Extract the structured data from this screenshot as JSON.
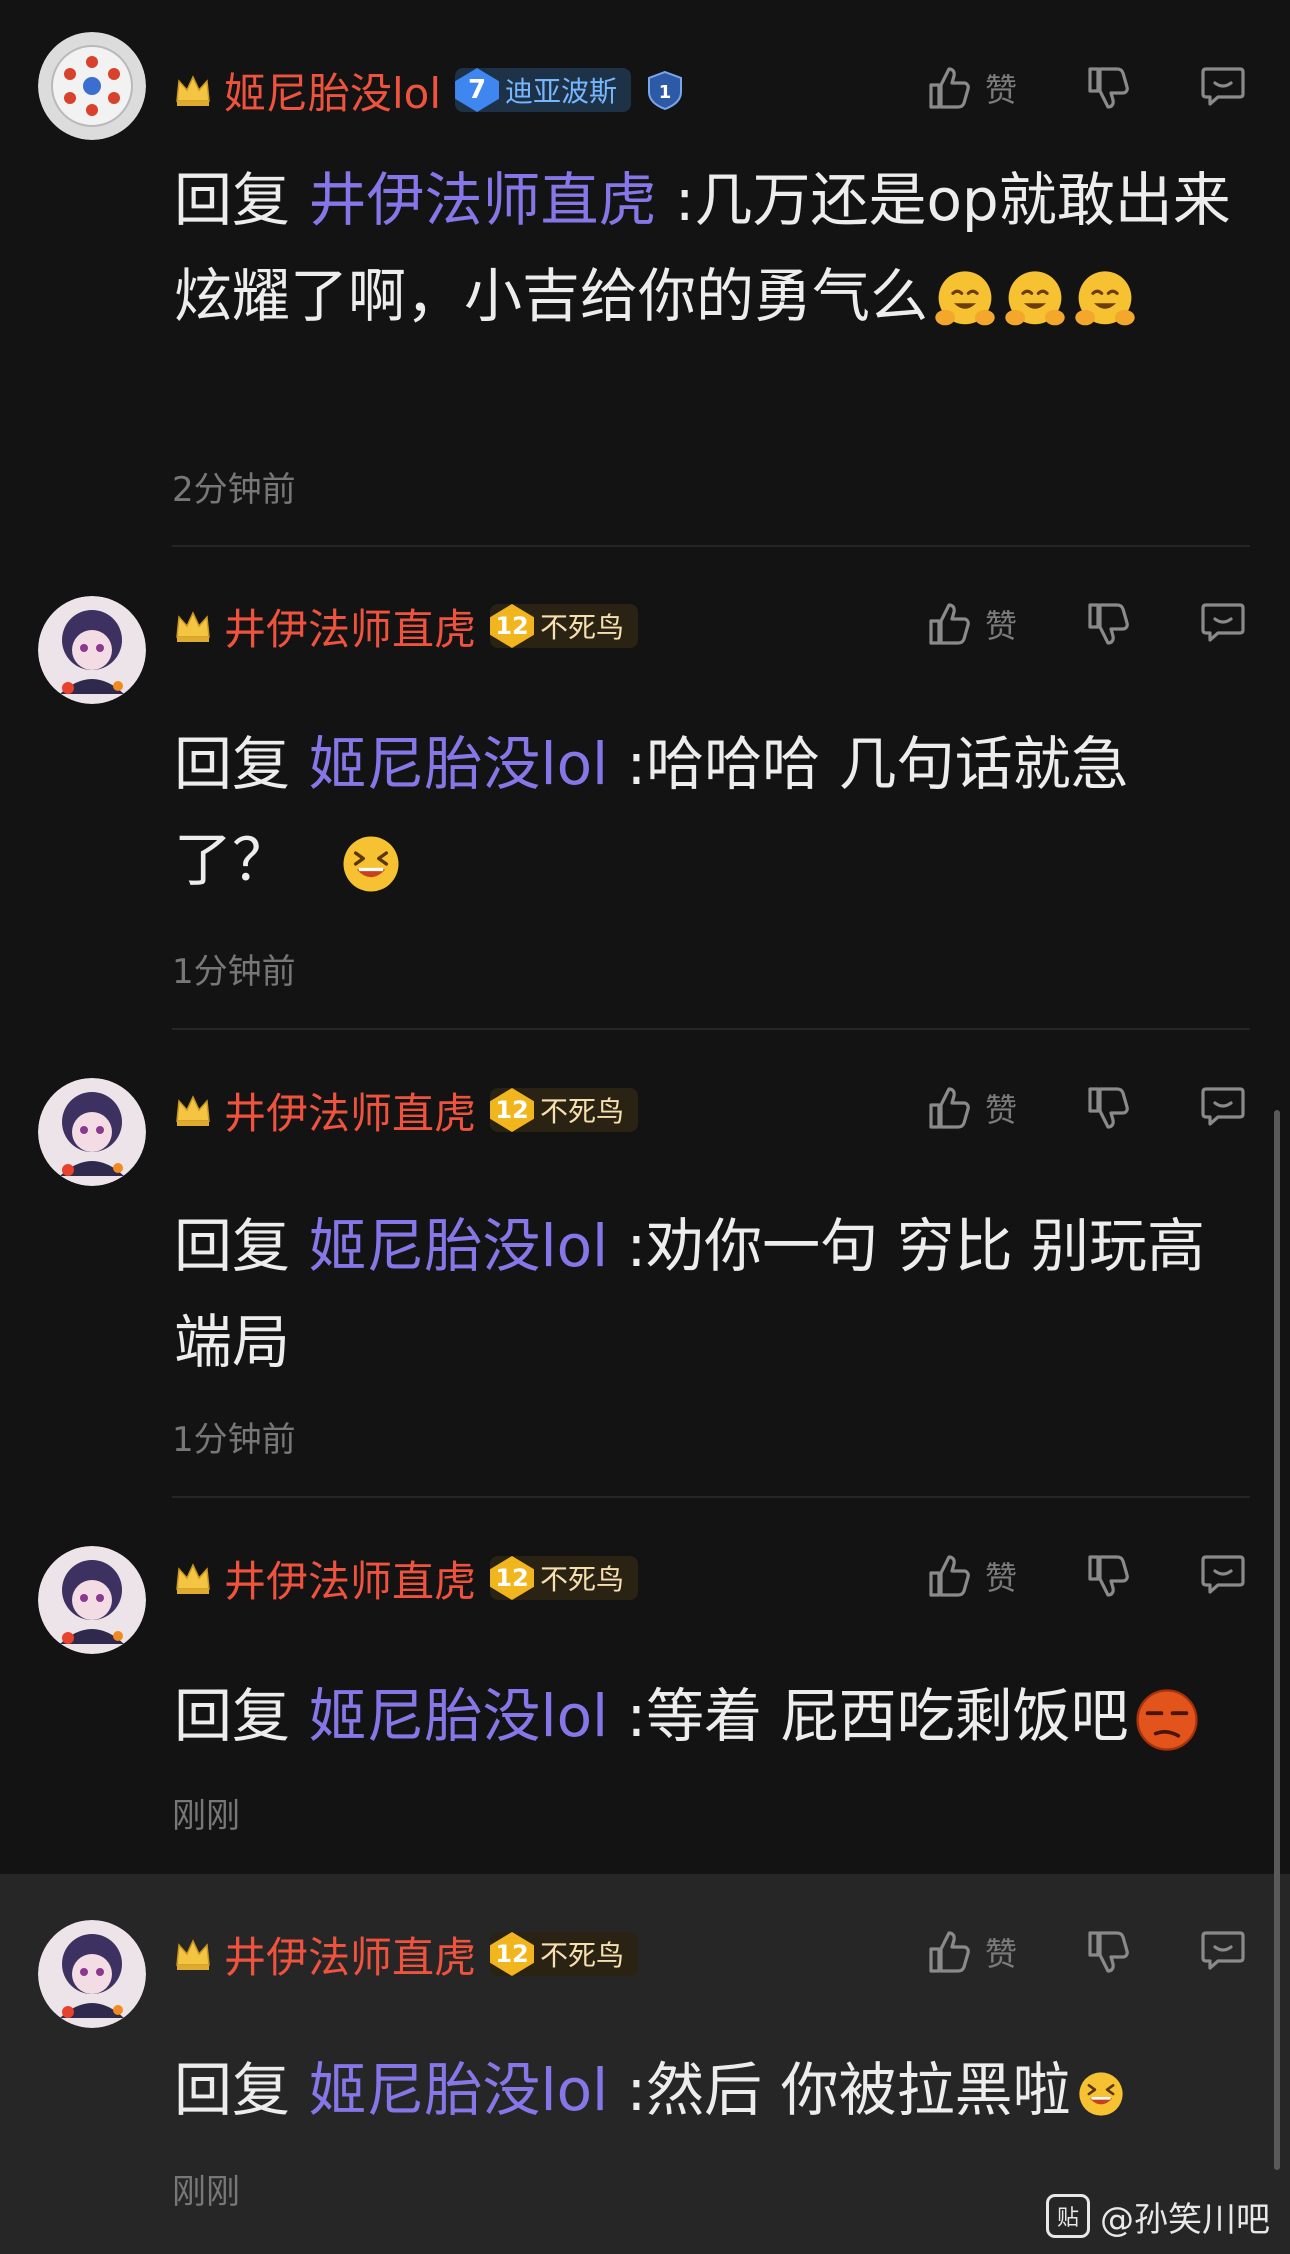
{
  "comments": [
    {
      "username": "姬尼胎没lol",
      "level": "7",
      "title": "迪亚波斯",
      "reply_prefix": "回复",
      "mention": "井伊法师直虎",
      "text": " :几万还是op就敢出来炫耀了啊，小吉给你的勇气么",
      "time": "2分钟前",
      "like_label": "赞"
    },
    {
      "username": "井伊法师直虎",
      "level": "12",
      "title": "不死鸟",
      "reply_prefix": "回复",
      "mention": "姬尼胎没lol",
      "text": " :哈哈哈 几句话就急了？",
      "time": "1分钟前",
      "like_label": "赞"
    },
    {
      "username": "井伊法师直虎",
      "level": "12",
      "title": "不死鸟",
      "reply_prefix": "回复",
      "mention": "姬尼胎没lol",
      "text": " :劝你一句 穷比 别玩高端局",
      "time": "1分钟前",
      "like_label": "赞"
    },
    {
      "username": "井伊法师直虎",
      "level": "12",
      "title": "不死鸟",
      "reply_prefix": "回复",
      "mention": "姬尼胎没lol",
      "text": " :等着 屁西吃剩饭吧",
      "time": "刚刚",
      "like_label": "赞"
    },
    {
      "username": "井伊法师直虎",
      "level": "12",
      "title": "不死鸟",
      "reply_prefix": "回复",
      "mention": "姬尼胎没lol",
      "text": " :然后 你被拉黑啦",
      "time": "刚刚",
      "like_label": "赞"
    }
  ],
  "first_rank_badge": "1",
  "watermark": "@孙笑川吧",
  "watermark_logo": "贴",
  "icons": {
    "like": "thumbs-up-icon",
    "dislike": "thumbs-down-icon",
    "reply": "comment-icon",
    "crown": "crown-icon"
  },
  "colors": {
    "background": "#131313",
    "username": "#f0533d",
    "mention": "#8577e8",
    "muted": "#777777"
  }
}
